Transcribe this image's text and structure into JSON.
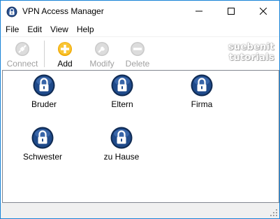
{
  "window": {
    "title": "VPN Access Manager"
  },
  "menu": [
    "File",
    "Edit",
    "View",
    "Help"
  ],
  "toolbar": {
    "connect_label": "Connect",
    "add_label": "Add",
    "modify_label": "Modify",
    "delete_label": "Delete"
  },
  "watermark": {
    "line1": "suebenit",
    "line2": "tutorials"
  },
  "connections": [
    "Bruder",
    "Eltern",
    "Firma",
    "Schwester",
    "zu Hause"
  ],
  "colors": {
    "accent_border": "#1883d7",
    "add_icon": "#f5b81c",
    "lock_icon": "#1b3a6b"
  }
}
